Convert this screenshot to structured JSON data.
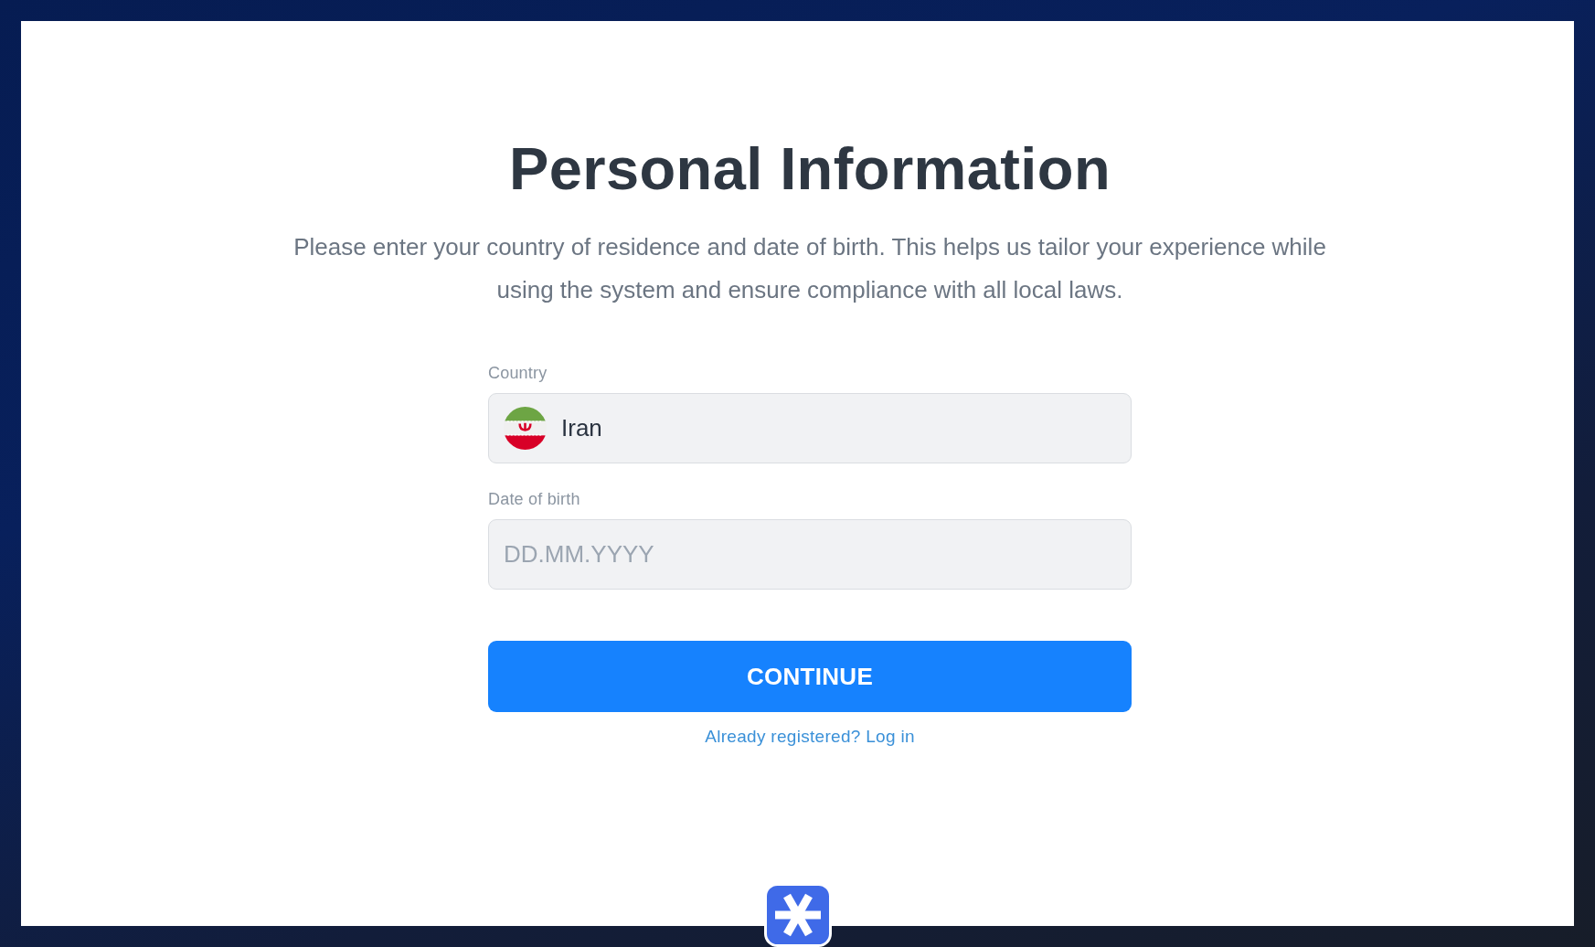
{
  "heading": "Personal Information",
  "description": "Please enter your country of residence and date of birth. This helps us tailor your experience while using the system and ensure compliance with all local laws.",
  "fields": [
    {
      "kind": "select",
      "label": "Country",
      "value": "Iran"
    },
    {
      "kind": "text",
      "label": "Date of birth",
      "placeholder": "DD.MM.YYYY"
    }
  ],
  "button": "CONTINUE",
  "login_link": "Already registered? Log in"
}
